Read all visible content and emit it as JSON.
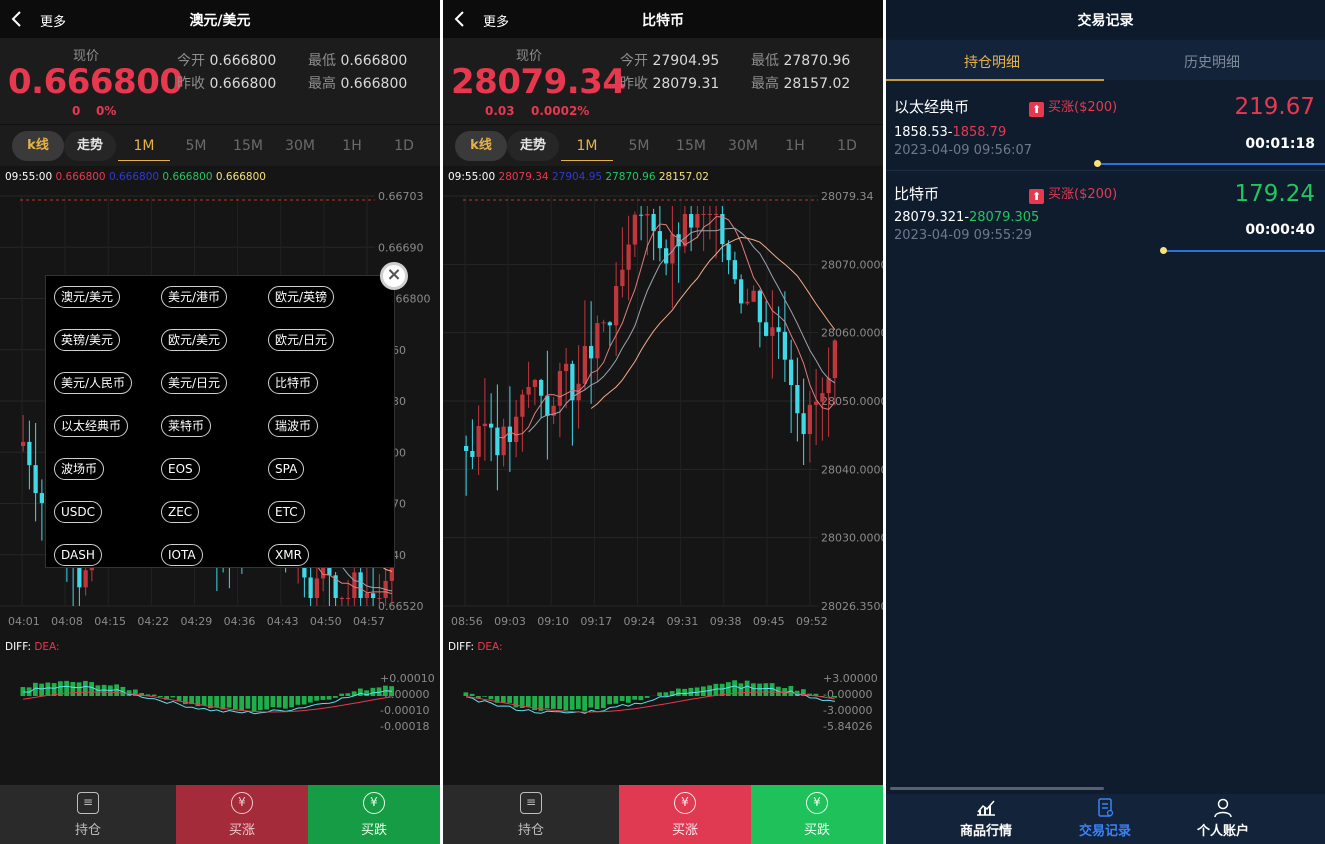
{
  "screens": [
    {
      "header": {
        "back": "更多",
        "title": "澳元/美元"
      },
      "quote": {
        "label": "现价",
        "price": "0.666800",
        "change": "0",
        "change_pct": "0%",
        "open_label": "今开",
        "open": "0.666800",
        "low_label": "最低",
        "low": "0.666800",
        "prev_label": "昨收",
        "prev": "0.666800",
        "high_label": "最高",
        "high": "0.666800"
      },
      "tabs": {
        "kline": "k线",
        "trend": "走势",
        "periods": [
          "1M",
          "5M",
          "15M",
          "30M",
          "1H",
          "1D"
        ],
        "active_period": "1M"
      },
      "chart": {
        "legend_time": "09:55:00",
        "legend_values": [
          "0.666800",
          "0.666800",
          "0.666800",
          "0.666800"
        ],
        "y_ticks": [
          "0.66703",
          "0.66690",
          "0.666800",
          "6660",
          "6630",
          "6600",
          "6570",
          "6540",
          "0.66520"
        ],
        "x_ticks": [
          "04:01",
          "04:08",
          "04:15",
          "04:22",
          "04:29",
          "04:36",
          "04:43",
          "04:50",
          "04:57"
        ],
        "macd_label": "DIFF:",
        "dea_label": "DEA:",
        "macd_ticks": [
          "+0.00010",
          "-0.00000",
          "-0.00010",
          "-0.00018"
        ]
      },
      "menu": {
        "items": [
          "澳元/美元",
          "美元/港币",
          "欧元/英镑",
          "英镑/美元",
          "欧元/美元",
          "欧元/日元",
          "美元/人民币",
          "美元/日元",
          "比特币",
          "以太经典币",
          "莱特币",
          "瑞波币",
          "波场币",
          "EOS",
          "SPA",
          "USDC",
          "ZEC",
          "ETC",
          "DASH",
          "IOTA",
          "XMR"
        ],
        "close": "×"
      },
      "bottom": {
        "hold": "持仓",
        "buy_up": "买涨",
        "buy_down": "买跌"
      }
    },
    {
      "header": {
        "back": "更多",
        "title": "比特币"
      },
      "quote": {
        "label": "现价",
        "price": "28079.34",
        "change": "0.03",
        "change_pct": "0.0002%",
        "open_label": "今开",
        "open": "27904.95",
        "low_label": "最低",
        "low": "27870.96",
        "prev_label": "昨收",
        "prev": "28079.31",
        "high_label": "最高",
        "high": "28157.02"
      },
      "tabs": {
        "kline": "k线",
        "trend": "走势",
        "periods": [
          "1M",
          "5M",
          "15M",
          "30M",
          "1H",
          "1D"
        ],
        "active_period": "1M"
      },
      "chart": {
        "legend_time": "09:55:00",
        "legend_values": [
          "28079.34",
          "27904.95",
          "27870.96",
          "28157.02"
        ],
        "y_ticks": [
          "28079.34",
          "28070.0000",
          "28060.0000",
          "28050.0000",
          "28040.0000",
          "28030.0000",
          "28026.3500"
        ],
        "x_ticks": [
          "08:56",
          "09:03",
          "09:10",
          "09:17",
          "09:24",
          "09:31",
          "09:38",
          "09:45",
          "09:52"
        ],
        "macd_label": "DIFF:",
        "dea_label": "DEA:",
        "macd_ticks": [
          "+3.00000",
          "-0.00000",
          "-3.00000",
          "-5.84026"
        ]
      },
      "bottom": {
        "hold": "持仓",
        "buy_up": "买涨",
        "buy_down": "买跌"
      }
    }
  ],
  "records": {
    "title": "交易记录",
    "tabs": [
      "持仓明细",
      "历史明细"
    ],
    "active_tab": "持仓明细",
    "items": [
      {
        "name": "以太经典币",
        "direction": "买涨",
        "amount": "($200)",
        "price": "219.67",
        "price_color": "#e8384f",
        "open_price": "1858.53",
        "cur_price": "1858.79",
        "cur_color": "#e8384f",
        "time": "2023-04-09 09:56:07",
        "remaining": "00:01:18",
        "progress": 0.52
      },
      {
        "name": "比特币",
        "direction": "买涨",
        "amount": "($200)",
        "price": "179.24",
        "price_color": "#22c55e",
        "open_price": "28079.321",
        "cur_price": "28079.305",
        "cur_color": "#22c55e",
        "time": "2023-04-09 09:55:29",
        "remaining": "00:00:40",
        "progress": 0.37
      }
    ],
    "nav": [
      "商品行情",
      "交易记录",
      "个人账户"
    ],
    "active_nav": "交易记录"
  },
  "colors": {
    "up": "#e8384f",
    "down": "#22c55e",
    "accent": "#e6b248",
    "cyan": "#22d3ee",
    "blue_nav": "#3b82f6"
  }
}
